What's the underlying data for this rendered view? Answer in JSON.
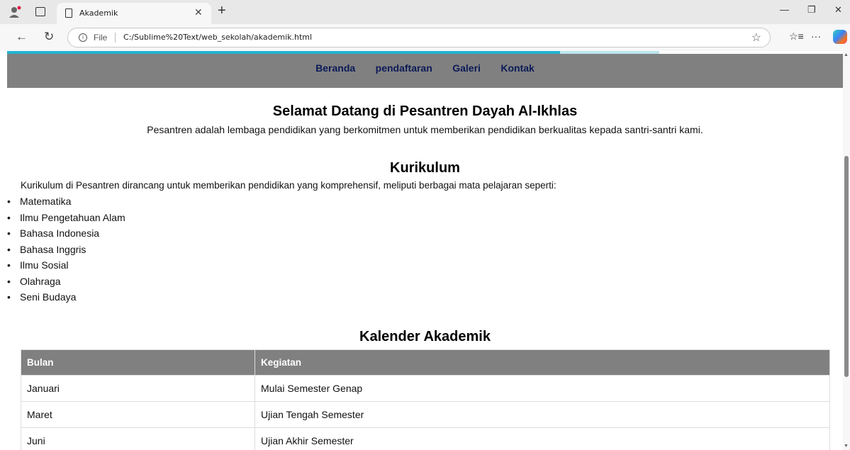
{
  "browser": {
    "tab_title": "Akademik",
    "file_label": "File",
    "url": "C:/Sublime%20Text/web_sekolah/akademik.html"
  },
  "nav": {
    "items": [
      "Beranda",
      "pendaftaran",
      "Galeri",
      "Kontak"
    ]
  },
  "welcome": {
    "title": "Selamat Datang di Pesantren Dayah Al-Ikhlas",
    "text": "Pesantren adalah lembaga pendidikan yang berkomitmen untuk memberikan pendidikan berkualitas kepada santri-santri kami."
  },
  "kurikulum": {
    "title": "Kurikulum",
    "description": "Kurikulum di Pesantren dirancang untuk memberikan pendidikan yang komprehensif, meliputi berbagai mata pelajaran seperti:",
    "subjects": [
      "Matematika",
      "Ilmu Pengetahuan Alam",
      "Bahasa Indonesia",
      "Bahasa Inggris",
      "Ilmu Sosial",
      "Olahraga",
      "Seni Budaya"
    ]
  },
  "kalender": {
    "title": "Kalender Akademik",
    "headers": [
      "Bulan",
      "Kegiatan"
    ],
    "rows": [
      [
        "Januari",
        "Mulai Semester Genap"
      ],
      [
        "Maret",
        "Ujian Tengah Semester"
      ],
      [
        "Juni",
        "Ujian Akhir Semester"
      ]
    ]
  },
  "colors": {
    "nav_bg": "#808080",
    "nav_link": "#0b1a57",
    "table_header_bg": "#808080",
    "accent": "#22b4d0"
  }
}
